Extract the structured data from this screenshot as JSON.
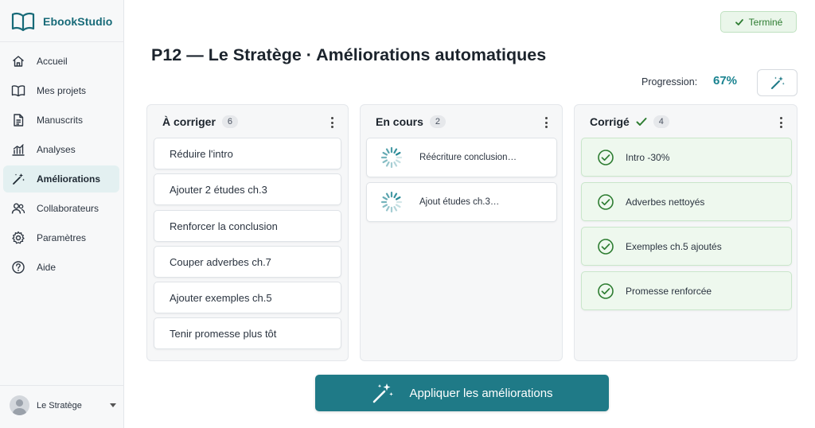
{
  "app": {
    "name": "EbookStudio"
  },
  "sidebar": {
    "items": [
      {
        "label": "Accueil",
        "icon": "home-icon",
        "active": false
      },
      {
        "label": "Mes projets",
        "icon": "book-icon",
        "active": false
      },
      {
        "label": "Manuscrits",
        "icon": "document-icon",
        "active": false
      },
      {
        "label": "Analyses",
        "icon": "chart-icon",
        "active": false
      },
      {
        "label": "Améliorations",
        "icon": "magic-wand-icon",
        "active": true
      },
      {
        "label": "Collaborateurs",
        "icon": "users-icon",
        "active": false
      },
      {
        "label": "Paramètres",
        "icon": "gear-icon",
        "active": false
      },
      {
        "label": "Aide",
        "icon": "help-icon",
        "active": false
      }
    ],
    "user": {
      "name": "Le Stratège"
    }
  },
  "header": {
    "status": "Terminé",
    "title": "P12 — Le Stratège · Améliorations automatiques",
    "progress_label": "Progression:",
    "progress_value": "67%"
  },
  "board": {
    "columns": [
      {
        "title": "À corriger",
        "count": "6",
        "cards": [
          "Réduire l'intro",
          "Ajouter 2 études ch.3",
          "Renforcer la conclusion",
          "Couper adverbes ch.7",
          "Ajouter exemples ch.5",
          "Tenir promesse plus tôt"
        ]
      },
      {
        "title": "En cours",
        "count": "2",
        "cards": [
          "Réécriture conclusion…",
          "Ajout études ch.3…"
        ]
      },
      {
        "title": "Corrigé",
        "count": "4",
        "cards": [
          "Intro -30%",
          "Adverbes nettoyés",
          "Exemples ch.5 ajoutés",
          "Promesse renforcée"
        ]
      }
    ]
  },
  "actions": {
    "apply_label": "Appliquer les améliorations"
  },
  "colors": {
    "brand": "#176a78",
    "accent": "#1f7a87",
    "success": "#2e7d32",
    "progress": "#1a8390"
  }
}
